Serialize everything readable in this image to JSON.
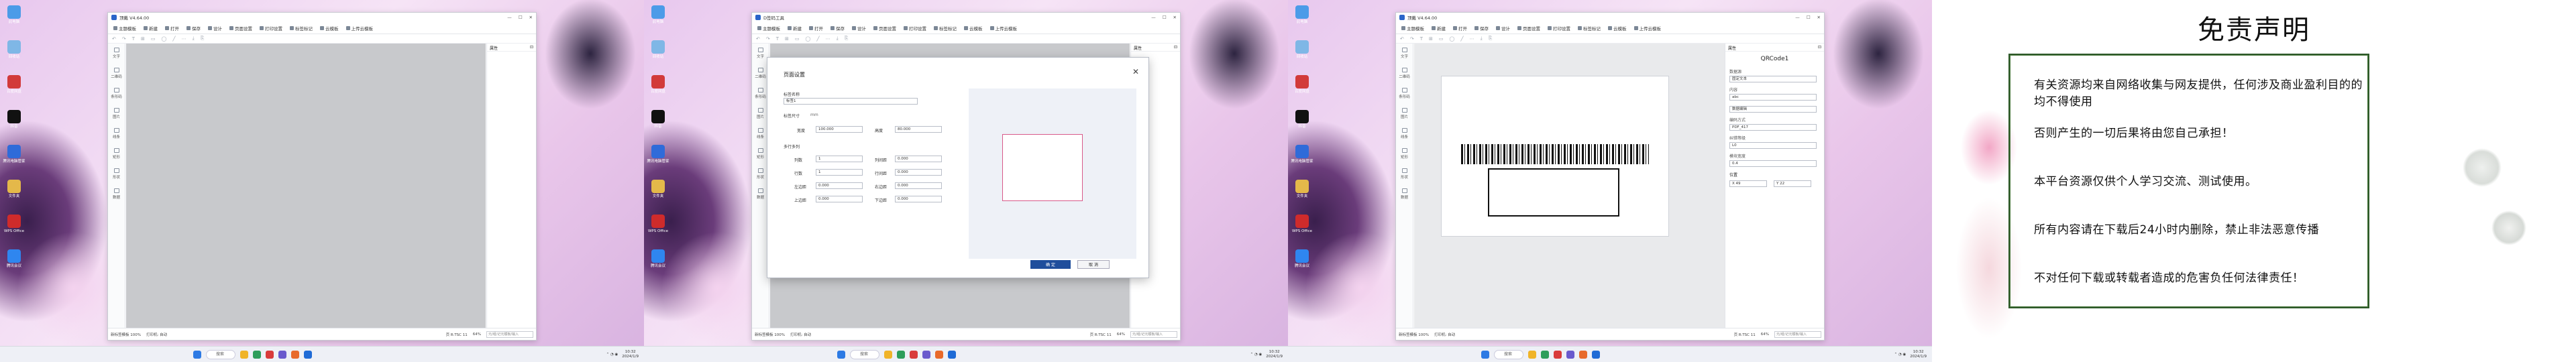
{
  "app": {
    "title": "顶戴 V4.64.00",
    "title_short": "D签码工具",
    "tabs": [
      "主题模板",
      "新建",
      "打开",
      "保存",
      "设计",
      "页面设置",
      "打印设置",
      "标签标记",
      "云模板",
      "上传云模板"
    ],
    "toolbar_glyphs": [
      "↶",
      "↷",
      "T",
      "⊞",
      "▭",
      "◯",
      "╱",
      "⋯",
      "⤓",
      "⎘"
    ],
    "sidebar": [
      "文字",
      "二维码",
      "条形码",
      "图片",
      "线条",
      "矩形",
      "形状",
      "数据"
    ],
    "right_panel_title": "属性",
    "status": {
      "left": "新标签模板 100%",
      "mid": "打印机: 自动",
      "right": "页 R:TSC 11",
      "zoom": "64%",
      "search": "元/组/记元模板/输入"
    }
  },
  "desktop_icons": [
    {
      "label": "此电脑",
      "color": "#4c9be8"
    },
    {
      "label": "回收站",
      "color": "#7fb7e6"
    },
    {
      "label": "百度网盘",
      "color": "#d23a3a"
    },
    {
      "label": "抖音",
      "color": "#111111"
    },
    {
      "label": "腾讯电脑管家",
      "color": "#2f6bd9"
    },
    {
      "label": "文件夹",
      "color": "#e4b84a"
    },
    {
      "label": "WPS Office",
      "color": "#cf2b2b"
    },
    {
      "label": "腾讯会议",
      "color": "#2f86ef"
    }
  ],
  "taskbar": {
    "search": "搜索",
    "time": "10:32",
    "date": "2024/1/9"
  },
  "page_setup": {
    "title": "页面设置",
    "name_label": "标签名称",
    "name_value": "标签1",
    "size_label": "标签尺寸",
    "unit": "mm",
    "width_label": "宽度",
    "width_value": "100.000",
    "height_label": "高度",
    "height_value": "80.000",
    "multi_label": "多行多列",
    "rows": [
      {
        "l": "列数",
        "v": "1",
        "r": "列间距",
        "rv": "0.000"
      },
      {
        "l": "行数",
        "v": "1",
        "r": "行间距",
        "rv": "0.000"
      },
      {
        "l": "左边距",
        "v": "0.000",
        "r": "右边距",
        "rv": "0.000"
      },
      {
        "l": "上边距",
        "v": "0.000",
        "r": "下边距",
        "rv": "0.000"
      }
    ],
    "ok": "确 定",
    "cancel": "取 消"
  },
  "qr_panel": {
    "title": "QRCode1",
    "fields": [
      {
        "label": "数据源",
        "value": "固定文本"
      },
      {
        "label": "内容",
        "value": "abc"
      },
      {
        "label": "",
        "value": "数据编辑"
      },
      {
        "label": "编码方式",
        "value": "PDF_417"
      },
      {
        "label": "纠错等级",
        "value": "L0"
      },
      {
        "label": "模块宽度",
        "value": "0.4"
      }
    ],
    "pos_label": "位置",
    "x": "X 49",
    "y": "Y 22"
  },
  "disclaimer": {
    "title": "免责声明",
    "lines": [
      "有关资源均来自网络收集与网友提供，任何涉及商业盈利目的的均不得使用",
      "否则产生的一切后果将由您自己承担！",
      "本平台资源仅供个人学习交流、测试使用。",
      "所有内容请在下载后24小时内删除，禁止非法恶意传播",
      "不对任何下载或转载者造成的危害负任何法律责任！"
    ]
  }
}
